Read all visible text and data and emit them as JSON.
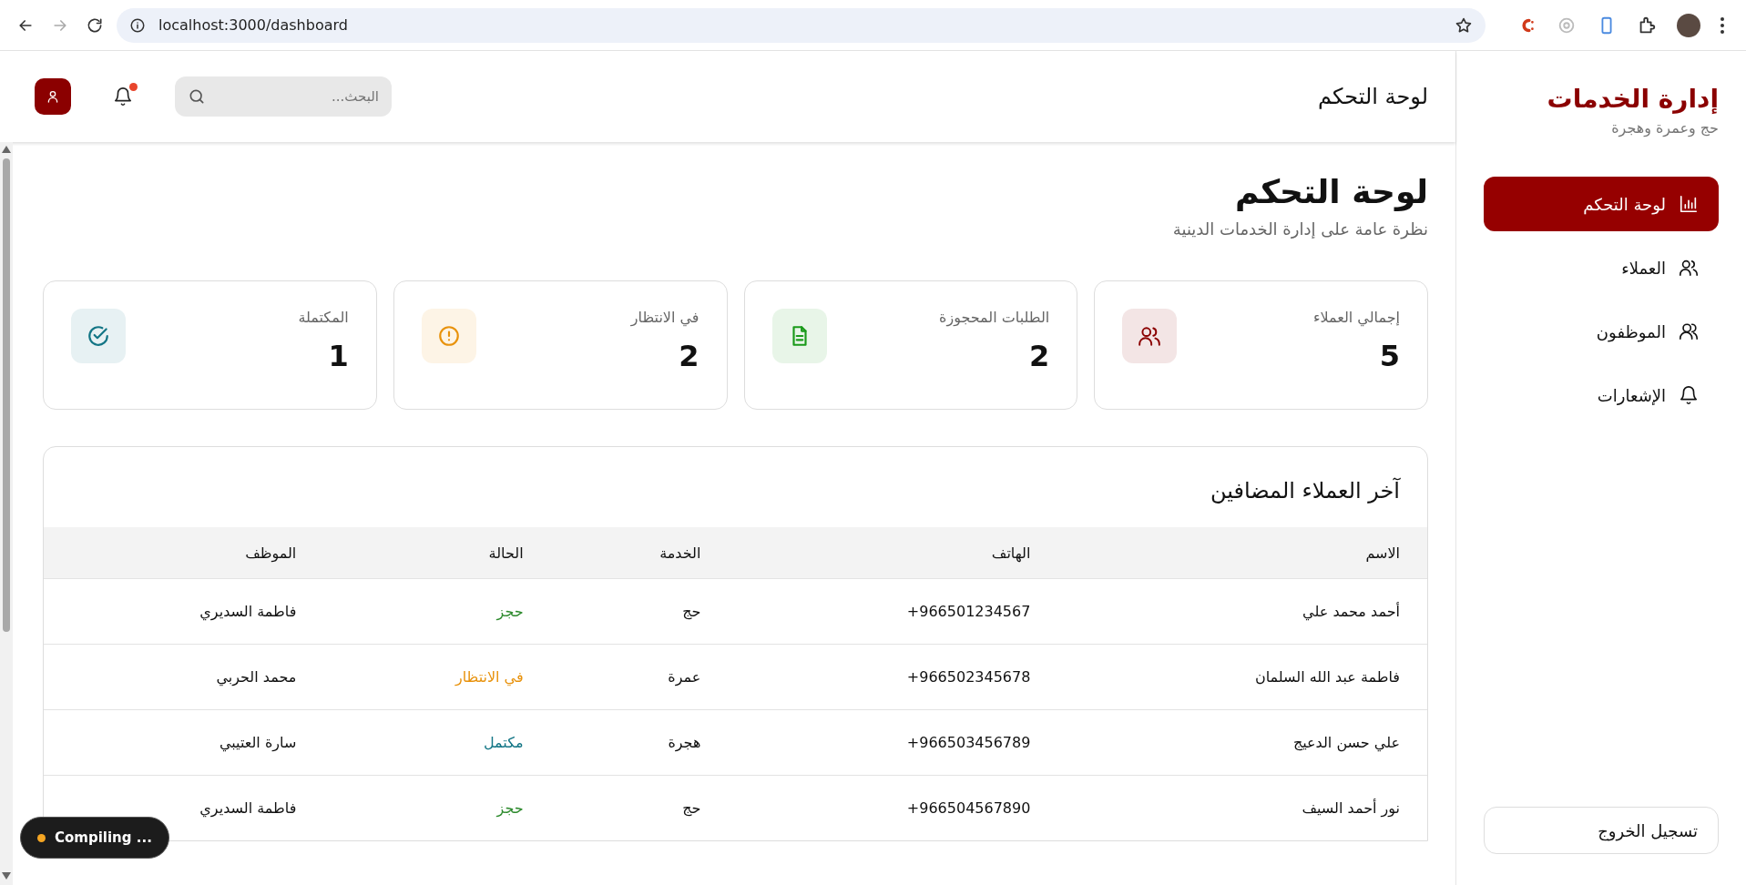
{
  "browser": {
    "url": "localhost:3000/dashboard"
  },
  "sidebar": {
    "title": "إدارة الخدمات",
    "subtitle": "حج وعمرة وهجرة",
    "items": [
      {
        "label": "لوحة التحكم",
        "selected": true
      },
      {
        "label": "العملاء",
        "selected": false
      },
      {
        "label": "الموظفون",
        "selected": false
      },
      {
        "label": "الإشعارات",
        "selected": false
      }
    ],
    "logout": "تسجيل الخروج"
  },
  "header": {
    "title": "لوحة التحكم",
    "search": {
      "placeholder": "البحث..."
    },
    "unread_notifications": true
  },
  "page": {
    "title": "لوحة التحكم",
    "subtitle": "نظرة عامة على إدارة الخدمات الدينية"
  },
  "stats": [
    {
      "label": "إجمالي العملاء",
      "value": "5",
      "color": "#8b0000"
    },
    {
      "label": "الطلبات المحجوزة",
      "value": "2",
      "color": "#1a9a1a"
    },
    {
      "label": "في الانتظار",
      "value": "2",
      "color": "#e8920c"
    },
    {
      "label": "المكتملة",
      "value": "1",
      "color": "#127585"
    }
  ],
  "table": {
    "title": "آخر العملاء المضافين",
    "columns": [
      "الاسم",
      "الهاتف",
      "الخدمة",
      "الحالة",
      "الموظف"
    ],
    "rows": [
      {
        "name": "أحمد محمد علي",
        "phone": "+966501234567",
        "service": "حج",
        "status": "حجز",
        "color": "#2e8b2e",
        "employee": "فاطمة السديري"
      },
      {
        "name": "فاطمة عبد الله السلمان",
        "phone": "+966502345678",
        "service": "عمرة",
        "status": "في الانتظار",
        "color": "#e8920c",
        "employee": "محمد الحربي"
      },
      {
        "name": "علي حسن الدعيج",
        "phone": "+966503456789",
        "service": "هجرة",
        "status": "مكتمل",
        "color": "#127585",
        "employee": "سارة العتيبي"
      },
      {
        "name": "نور أحمد السيف",
        "phone": "+966504567890",
        "service": "حج",
        "status": "حجز",
        "color": "#2e8b2e",
        "employee": "فاطمة السديري"
      }
    ]
  },
  "dev_indicator": {
    "label": "Compiling ..."
  }
}
